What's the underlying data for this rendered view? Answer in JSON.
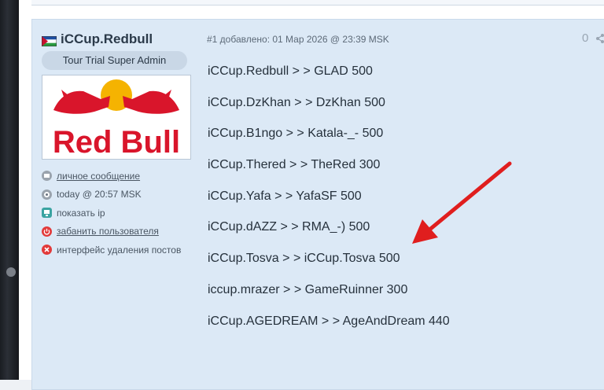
{
  "post": {
    "author": "iCCup.Redbull",
    "role": "Tour Trial Super Admin",
    "meta": "#1 добавлено: 01 Мар 2026 @ 23:39 MSK",
    "score": "0",
    "logo_text": "Red Bull",
    "actions": [
      {
        "label": "личное сообщение",
        "icon": "message-icon"
      },
      {
        "label": "today @ 20:57 MSK",
        "icon": "clock-icon"
      },
      {
        "label": "показать ip",
        "icon": "monitor-icon"
      },
      {
        "label": "забанить пользователя",
        "icon": "power-icon"
      },
      {
        "label": "интерфейс удаления постов",
        "icon": "delete-icon"
      }
    ],
    "lines": [
      "iCCup.Redbull > > GLAD 500",
      "iCCup.DzKhan > > DzKhan 500",
      "iCCup.B1ngo > > Katala-_- 500",
      "iCCup.Thered > > TheRed 300",
      "iCCup.Yafa > > YafaSF 500",
      "iCCup.dAZZ > > RMA_-) 500",
      "iCCup.Tosva > > iCCup.Tosva 500",
      "iccup.mrazer > > GameRuinner 300",
      "iCCup.AGEDREAM > > AgeAndDream 440"
    ]
  },
  "colors": {
    "post_bg": "#dce9f6",
    "arrow": "#e01e1e",
    "brand_red": "#d9152b",
    "brand_yellow": "#f5b301"
  }
}
